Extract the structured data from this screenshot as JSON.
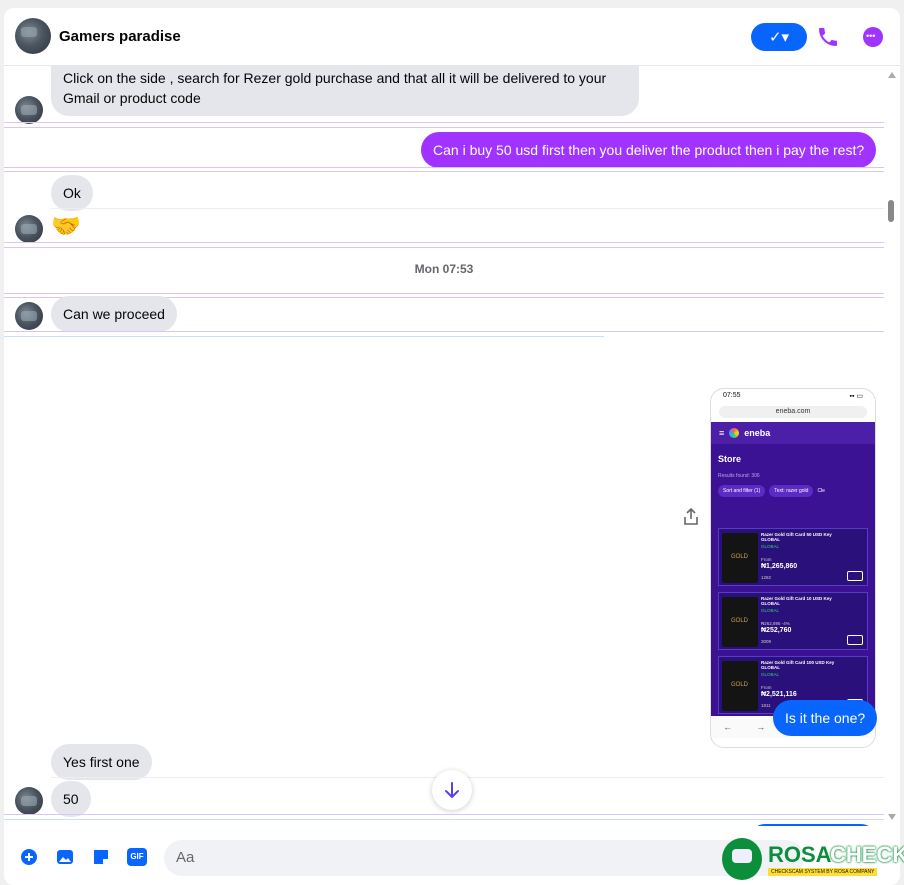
{
  "header": {
    "chat_name": "Gamers paradise",
    "check_label": "✓▾"
  },
  "messages": {
    "m1": "Click on the side , search for Rezer gold purchase and that all it will be delivered to your Gmail or product code",
    "m2": "Can i buy 50 usd first then you deliver the product then i pay the rest?",
    "m3": "Ok",
    "m4": "🤝",
    "timestamp": "Mon 07:53",
    "m5": "Can we proceed",
    "m6": "Is it the one?",
    "m7": "Yes first one",
    "m8": "50"
  },
  "screenshot_attachment": {
    "time": "07:55",
    "url": "eneba.com",
    "brand": "eneba",
    "store_title": "Store",
    "results": "Results found: 306",
    "chip_sort": "Sort and filter (1)",
    "chip_text": "Text: razer gold",
    "chip_extra": "Cle",
    "cards": [
      {
        "title": "Razer Gold Gift Card 50 USD Key GLOBAL",
        "region": "GLOBAL",
        "from": "From",
        "price": "₦1,265,860",
        "likes": "1282"
      },
      {
        "title": "Razer Gold Gift Card 10 USD Key GLOBAL",
        "region": "GLOBAL",
        "from": "₦262,895 -4%",
        "price": "₦252,760",
        "likes": "3009"
      },
      {
        "title": "Razer Gold Gift Card 100 USD Key GLOBAL",
        "region": "GLOBAL",
        "from": "From",
        "price": "₦2,521,116",
        "likes": "1811"
      }
    ]
  },
  "composer": {
    "placeholder": "Aa"
  },
  "watermark": {
    "brand_a": "ROSA",
    "brand_b": "CHECK",
    "tagline": "CHECKSCAM SYSTEM BY ROSA COMPANY"
  },
  "colors": {
    "outgoing_purple": "#a033ff",
    "outgoing_blue": "#0866ff",
    "incoming_gray": "#e4e6eb"
  }
}
